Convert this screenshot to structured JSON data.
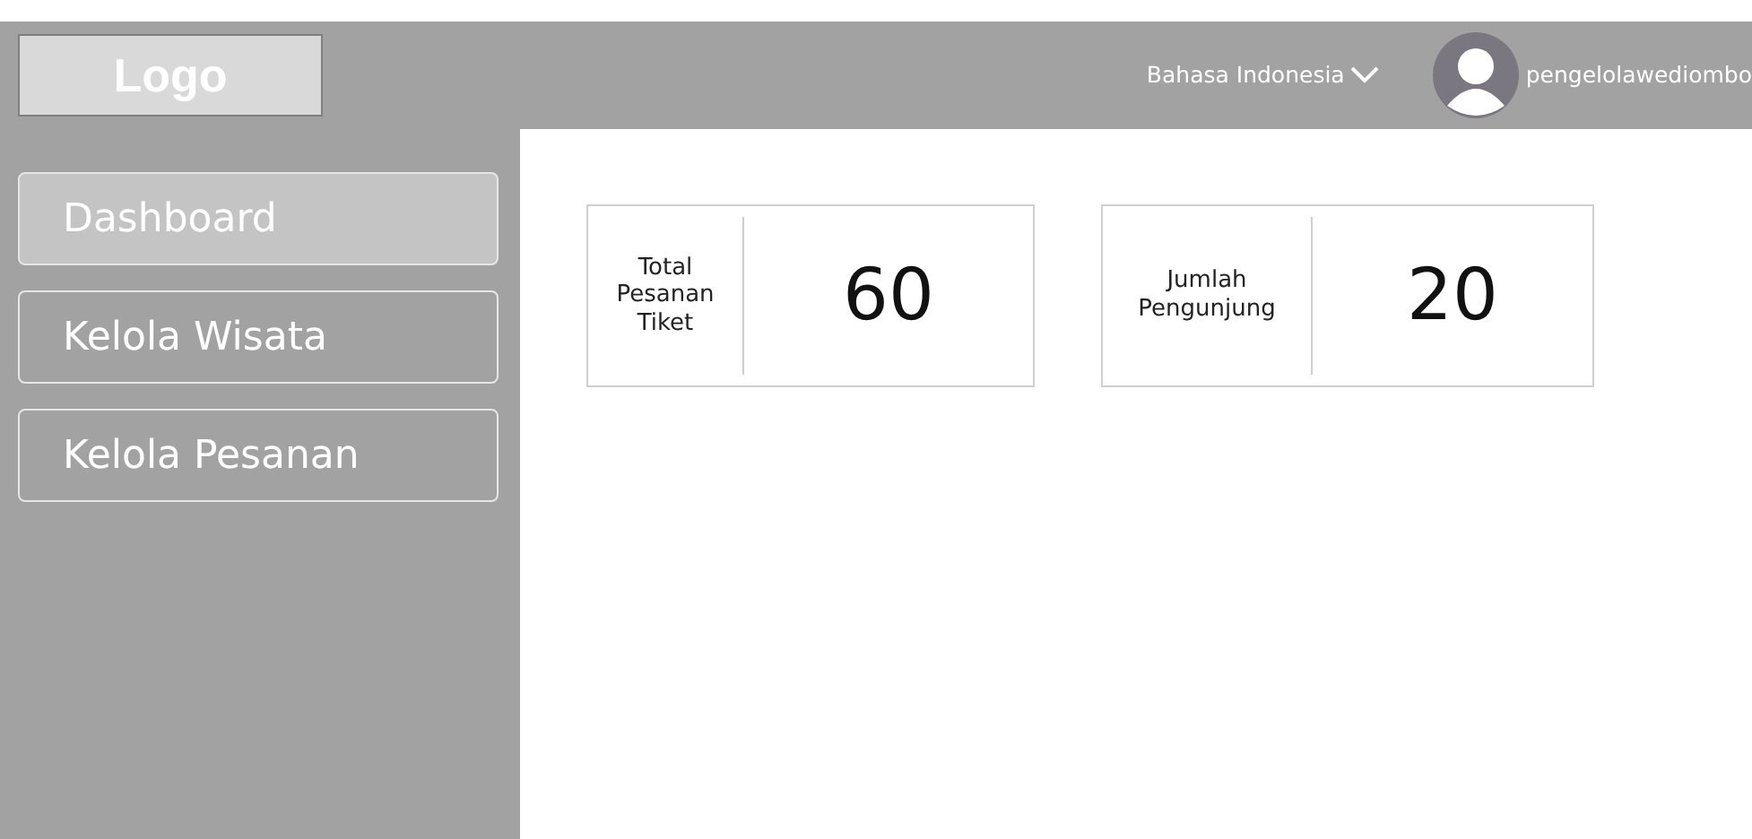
{
  "header": {
    "logo": "Logo",
    "language": "Bahasa Indonesia",
    "user": "pengelolawediombo"
  },
  "sidebar": {
    "items": [
      {
        "label": "Dashboard",
        "selected": true
      },
      {
        "label": "Kelola Wisata",
        "selected": false
      },
      {
        "label": "Kelola Pesanan",
        "selected": false
      }
    ]
  },
  "stats": [
    {
      "label": "Total Pesanan Tiket",
      "value": "60"
    },
    {
      "label": "Jumlah Pengunjung",
      "value": "20"
    }
  ]
}
